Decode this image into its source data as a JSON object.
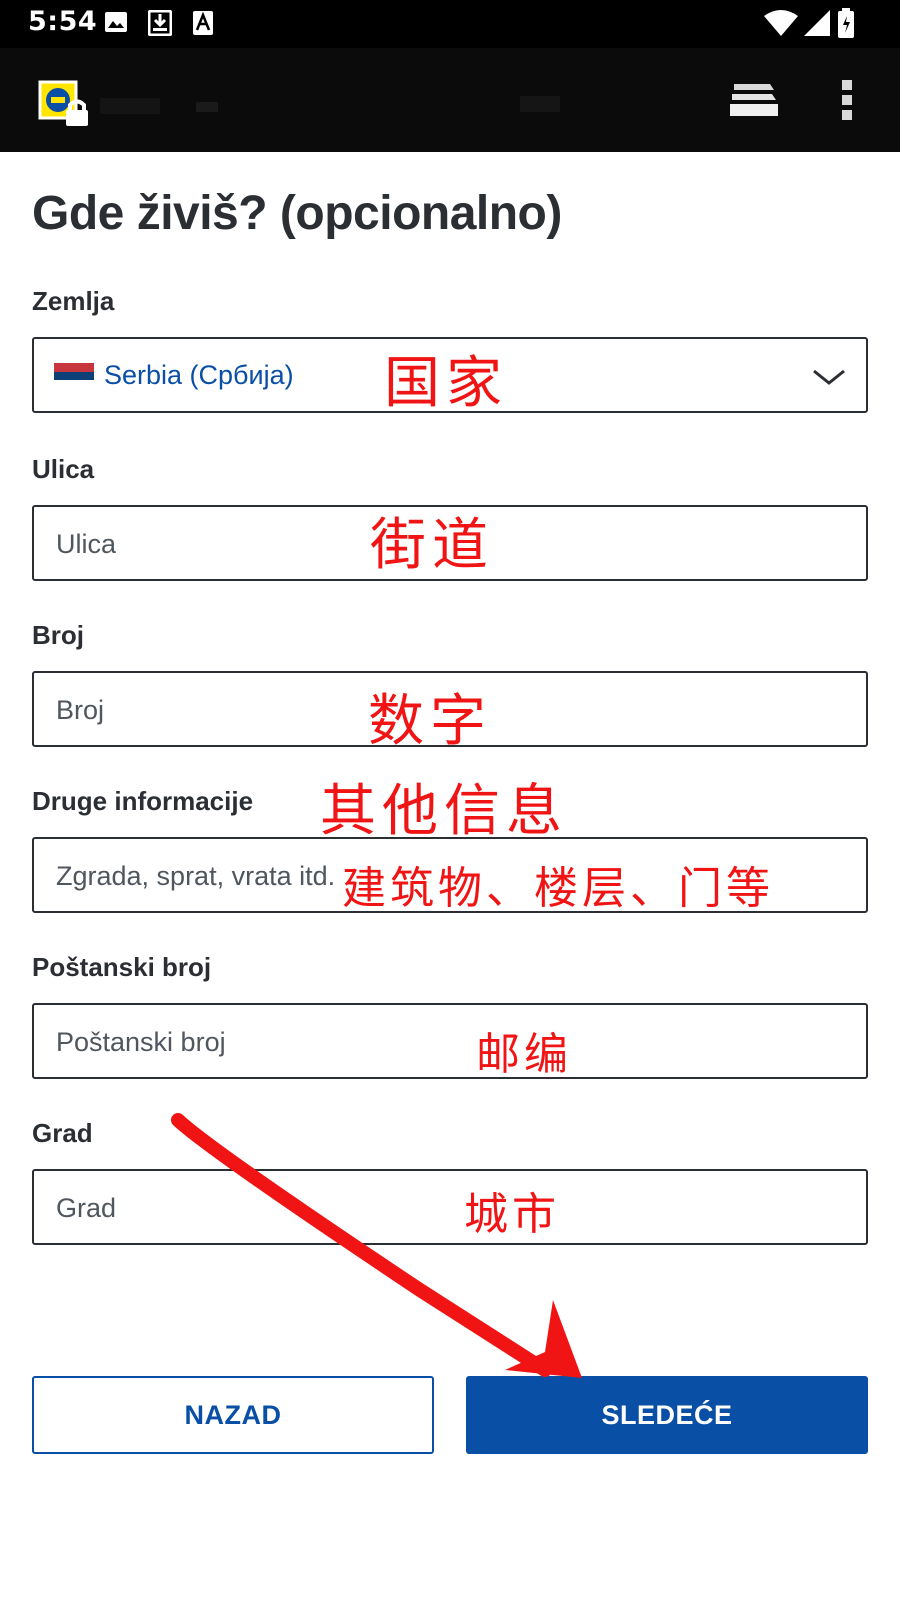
{
  "status_bar": {
    "time": "5:54"
  },
  "form": {
    "heading": "Gde živiš? (opcionalno)",
    "fields": [
      {
        "label": "Zemlja",
        "value": "Serbia (Србија)",
        "annotation": "国家"
      },
      {
        "label": "Ulica",
        "placeholder": "Ulica",
        "annotation": "街道"
      },
      {
        "label": "Broj",
        "placeholder": "Broj",
        "annotation": "数字"
      },
      {
        "label": "Druge informacije",
        "placeholder": "Zgrada, sprat, vrata itd.",
        "label_annotation": "其他信息",
        "annotation": "建筑物、楼层、门等"
      },
      {
        "label": "Poštanski broj",
        "placeholder": "Poštanski broj",
        "annotation": "邮编"
      },
      {
        "label": "Grad",
        "placeholder": "Grad",
        "annotation": "城市"
      }
    ]
  },
  "buttons": {
    "back": "NAZAD",
    "next": "SLEDEĆE"
  },
  "colors": {
    "brand_blue": "#0a4fa6",
    "annotation_red": "#f01414",
    "flag": [
      "#c6363c",
      "#0c4076",
      "#ffffff"
    ]
  },
  "icons": [
    "image-icon",
    "download-icon",
    "font-icon",
    "wifi-icon",
    "signal-icon",
    "battery-icon",
    "lidl-lock-icon",
    "tabs-icon",
    "overflow-menu-icon",
    "chevron-down-icon",
    "serbia-flag-icon"
  ]
}
